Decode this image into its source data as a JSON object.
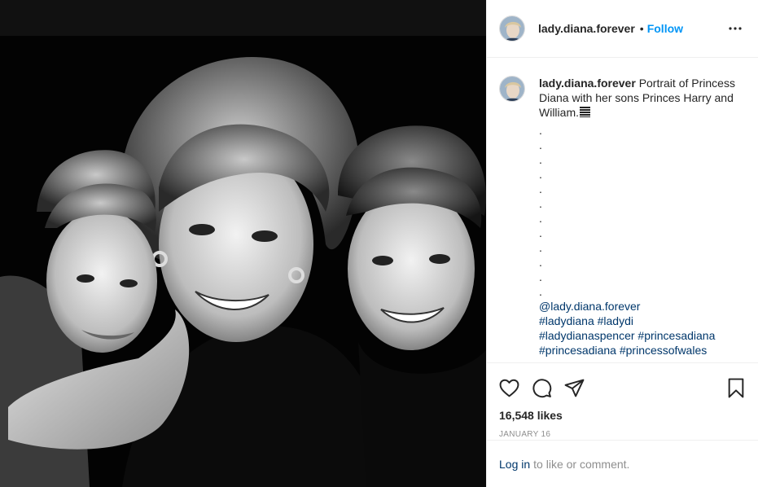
{
  "post": {
    "username": "lady.diana.forever",
    "follow_label": "Follow",
    "separator": "•",
    "caption": {
      "text": "Portrait of Princess Diana with her sons Princes Harry and William.",
      "dots": [
        ".",
        ".",
        ".",
        ".",
        ".",
        ".",
        ".",
        ".",
        ".",
        ".",
        ".",
        "."
      ],
      "hashtags": [
        "@lady.diana.forever",
        "#ladydiana #ladydi",
        "#ladydianaspencer #princesadiana",
        "#princesadiana #princessofwales"
      ]
    },
    "likes": "16,548 likes",
    "date": "JANUARY 16",
    "login": {
      "link": "Log in",
      "text": "to like or comment."
    }
  },
  "icons": {
    "more": "more-options-icon",
    "like": "heart-icon",
    "comment": "comment-bubble-icon",
    "share": "paper-plane-icon",
    "save": "bookmark-icon"
  },
  "colors": {
    "follow": "#0095f6",
    "link": "#00376b",
    "secondary": "#8e8e8e",
    "border": "#efefef"
  }
}
